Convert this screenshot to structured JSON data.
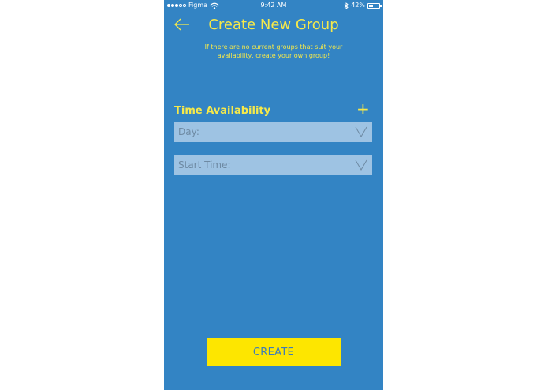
{
  "statusbar": {
    "carrier": "Figma",
    "time": "9:42 AM",
    "battery": "42%",
    "battery_level": 0.42
  },
  "header": {
    "title": "Create New Group",
    "subtitle": "If there are no current groups that suit your availability, create your own group!"
  },
  "availability": {
    "label": "Time Availability",
    "add_icon": "plus-icon",
    "fields": [
      {
        "label": "Day:",
        "icon": "chevron-down-icon"
      },
      {
        "label": "Start Time:",
        "icon": "chevron-down-icon"
      }
    ]
  },
  "actions": {
    "create_label": "CREATE"
  },
  "colors": {
    "background": "#3384c4",
    "accent": "#f6e94a",
    "button": "#fde600",
    "field": "#9ec3e3"
  }
}
